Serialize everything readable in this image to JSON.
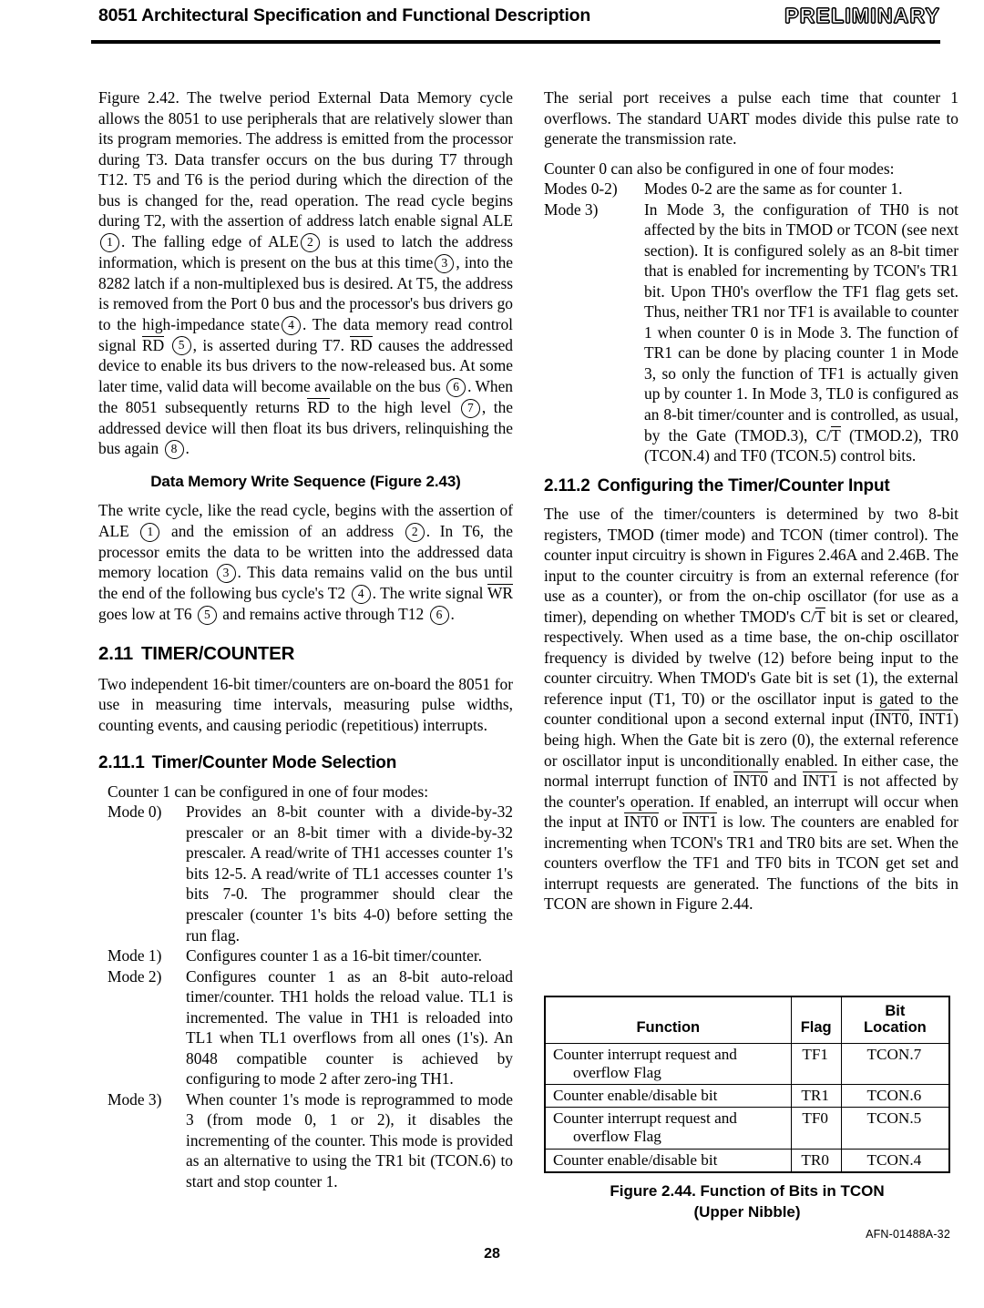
{
  "header": {
    "title": "8051 Architectural Specification and Functional Description",
    "stamp": "PRELIMINARY"
  },
  "left_column": {
    "para_figure_242": {
      "s1": "Figure 2.42. The twelve period External Data Memory cycle allows the 8051 to use peripherals that are relatively slower than its program memories. The address is emitted from the processor during T3. Data transfer occurs on the bus during T7 through T12. T5 and T6 is the period during which the direction of the bus is changed for the, read operation. The read cycle begins during T2, with the assertion of address latch enable signal ALE",
      "m1": "1",
      "s2": ". The falling edge of ALE",
      "m2": "2",
      "s3": "is used to latch the address information, which is present on the bus at this time",
      "m3": "3",
      "s4": ", into the 8282 latch if a non-multiplexed bus is desired. At T5, the address is removed from the Port 0 bus and the processor's bus drivers go to the high-impedance state",
      "m4": "4",
      "s5": ". The data memory read control signal",
      "rd1": "RD",
      "m5": "5",
      "s6": ", is asserted during T7.",
      "rd2": "RD",
      "s7": "causes the addressed device to enable its bus drivers to the now-released bus. At some later time, valid data will become available on the bus",
      "m6": "6",
      "s8": ". When the 8051 subsequently returns",
      "rd3": "RD",
      "s9": "to the high level",
      "m7": "7",
      "s10": ", the addressed device will then float its bus drivers, relinquishing the bus again",
      "m8": "8",
      "s11": "."
    },
    "write_seq_heading": "Data Memory Write Sequence (Figure 2.43)",
    "para_write": {
      "s1": "The write cycle, like the read cycle, begins with the assertion of ALE",
      "m1": "1",
      "s2": "and the emission of an address",
      "m2": "2",
      "s3": ". In T6, the processor emits the data to be written into the addressed data memory location",
      "m3": "3",
      "s4": ". This data remains valid on the bus until the end of the following bus cycle's T2",
      "m4": "4",
      "s5": ". The write signal",
      "wr": "WR",
      "s6": "goes low at T6",
      "m5": "5",
      "s7": "and remains active through T12",
      "m6": "6",
      "s8": "."
    },
    "section_211": {
      "num": "2.11",
      "title": "TIMER/COUNTER"
    },
    "para_211": "Two independent 16-bit timer/counters are on-board the 8051 for use in measuring time intervals, measuring pulse widths, counting events, and causing periodic (repetitious) interrupts.",
    "section_2111": {
      "num": "2.11.1",
      "title": "Timer/Counter Mode Selection"
    },
    "modes_lead_in": "Counter 1 can be configured in one of four modes:",
    "modes": [
      {
        "label": "Mode 0)",
        "text": "Provides an 8-bit counter with a divide-by-32 prescaler or an 8-bit timer with a divide-by-32 prescaler. A read/write of TH1 accesses counter 1's bits 12-5. A read/write of TL1 accesses counter 1's bits 7-0. The programmer should clear the prescaler (counter 1's bits 4-0) before setting the run flag."
      },
      {
        "label": "Mode 1)",
        "text": "Configures counter 1 as a 16-bit timer/counter."
      },
      {
        "label": "Mode 2)",
        "text": "Configures counter 1 as an 8-bit auto-reload timer/counter. TH1 holds the reload value. TL1 is incremented. The value in TH1 is reloaded into TL1 when TL1 overflows from all ones (1's). An 8048 compatible counter is achieved by configuring to mode 2 after zero-ing TH1."
      },
      {
        "label": "Mode 3)",
        "text": "When counter 1's mode is reprogrammed to mode 3 (from mode 0, 1 or 2), it disables the incrementing of the counter. This mode is provided as an alternative to using the TR1 bit (TCON.6) to start and stop counter 1."
      }
    ]
  },
  "right_column": {
    "para_serial": "The serial port receives a pulse each time that counter 1 overflows. The standard UART modes divide this pulse rate to generate the transmission rate.",
    "counter0_lead_in": "Counter 0 can also be configured in one of four modes:",
    "modes": [
      {
        "label": "Modes 0-2)",
        "text": "Modes 0-2 are the same as for counter 1."
      },
      {
        "label": "Mode 3)",
        "text_part1": "In Mode 3, the configuration of TH0 is not affected by the bits in TMOD or TCON (see next section). It is configured solely as an 8-bit timer that is enabled for incrementing by TCON's TR1 bit. Upon TH0's overflow the TF1 flag gets set. Thus, neither TR1 nor TF1 is available to counter 1 when counter 0 is in Mode 3. The function of TR1 can be done by placing counter 1 in Mode 3, so only the function of TF1 is actually given up by counter 1. In Mode 3, TL0 is configured as an 8-bit timer/counter and is controlled, as usual, by the Gate (TMOD.3), C/",
        "overline_t": "T",
        "text_part2": "(TMOD.2), TR0 (TCON.4) and TF0 (TCON.5) control bits."
      }
    ],
    "section_2112": {
      "num": "2.11.2",
      "title": "Configuring the Timer/Counter Input"
    },
    "para_2112": {
      "s1": "The use of the timer/counters is determined by two 8-bit registers, TMOD (timer mode) and TCON (timer control). The counter input circuitry is shown in Figures 2.46A and 2.46B. The input to the counter circuitry is from an external reference (for use as a counter), or from the on-chip oscillator (for use as a timer), depending on whether TMOD's C/",
      "ovl1": "T",
      "s2": "bit is set or cleared, respectively. When used as a time base, the on-chip oscillator frequency is divided by twelve (12) before being input to the counter circuitry. When TMOD's Gate bit is set (1), the external reference input (T1, T0) or the oscillator input is gated to the counter conditional upon a second external input (",
      "ovl2": "INT0",
      "s3": ",",
      "ovl3": "INT1",
      "s4": ") being high. When the Gate bit is zero (0), the external reference or oscillator input is unconditionally enabled. In either case, the normal interrupt function of",
      "ovl4": "INT0",
      "s5": "and",
      "ovl5": "INT1",
      "s6": "is not affected by the counter's operation. If enabled, an interrupt will occur when the input at",
      "ovl6": "INT0",
      "s7": "or",
      "ovl7": "INT1",
      "s8": "is low. The counters are enabled for incrementing when TCON's TR1 and TR0 bits are set. When the counters overflow the TF1 and TF0 bits in TCON get set and interrupt requests are generated. The functions of the bits in TCON are shown in Figure 2.44."
    }
  },
  "table": {
    "headers": {
      "function": "Function",
      "flag": "Flag",
      "bit_location_line1": "Bit",
      "bit_location_line2": "Location"
    },
    "rows": [
      {
        "function_line1": "Counter interrupt request and",
        "function_line2": "overflow Flag",
        "flag": "TF1",
        "bit_location": "TCON.7"
      },
      {
        "function_line1": "Counter enable/disable bit",
        "function_line2": "",
        "flag": "TR1",
        "bit_location": "TCON.6"
      },
      {
        "function_line1": "Counter interrupt request and",
        "function_line2": "overflow Flag",
        "flag": "TF0",
        "bit_location": "TCON.5"
      },
      {
        "function_line1": "Counter enable/disable bit",
        "function_line2": "",
        "flag": "TR0",
        "bit_location": "TCON.4"
      }
    ]
  },
  "figure_caption": {
    "line1": "Figure 2.44.  Function of Bits in TCON",
    "line2": "(Upper Nibble)"
  },
  "footer": {
    "afn": "AFN-01488A-32",
    "page_number": "28"
  }
}
